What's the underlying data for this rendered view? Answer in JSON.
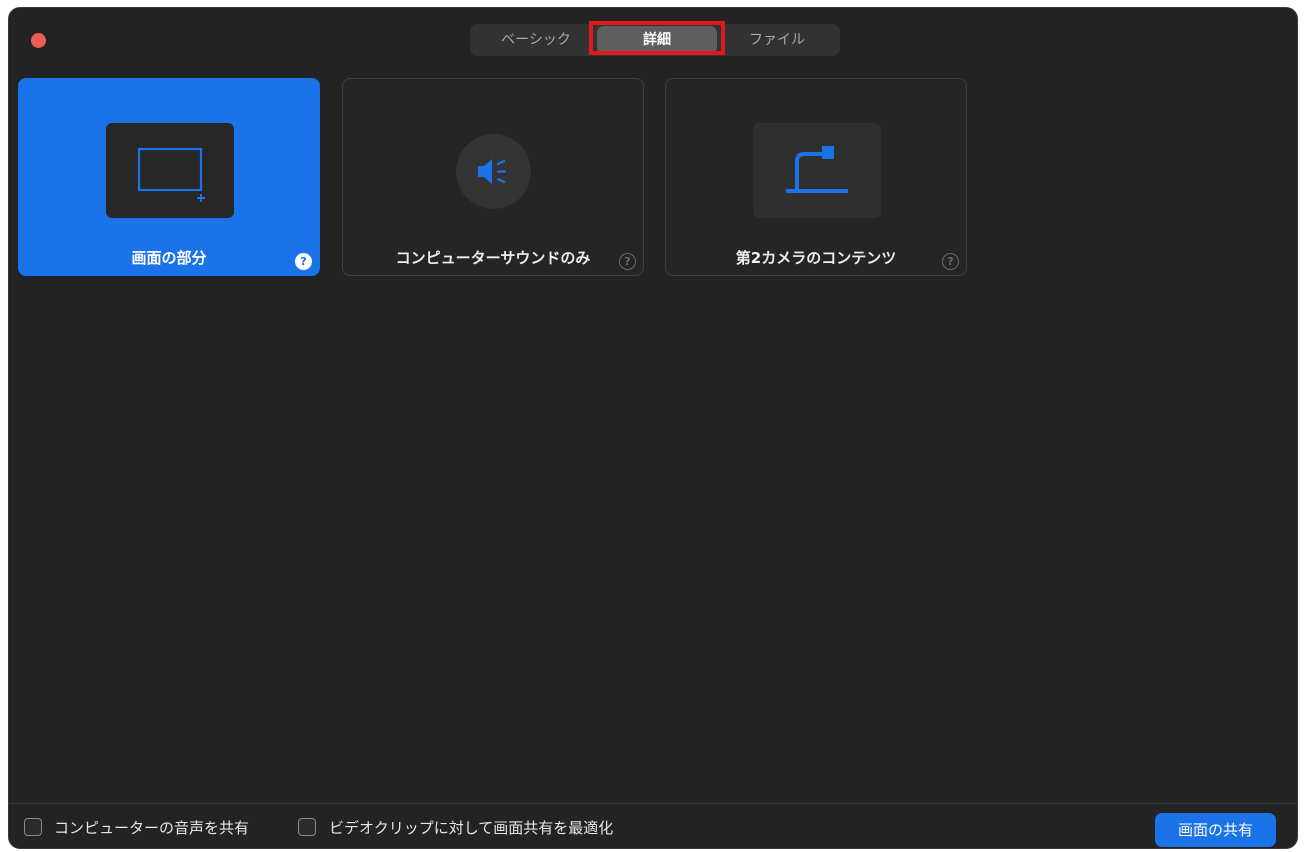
{
  "tabs": [
    {
      "label": "ベーシック",
      "active": false
    },
    {
      "label": "詳細",
      "active": true
    },
    {
      "label": "ファイル",
      "active": false
    }
  ],
  "cards": [
    {
      "label": "画面の部分",
      "icon": "screen-portion-icon",
      "selected": true,
      "help": "?"
    },
    {
      "label": "コンピューターサウンドのみ",
      "icon": "speaker-icon",
      "selected": false,
      "help": "?"
    },
    {
      "label": "第2カメラのコンテンツ",
      "icon": "document-camera-icon",
      "selected": false,
      "help": "?"
    }
  ],
  "footer": {
    "share_audio_label": "コンピューターの音声を共有",
    "optimize_video_label": "ビデオクリップに対して画面共有を最適化",
    "share_button_label": "画面の共有"
  },
  "colors": {
    "accent": "#1a73e8",
    "background": "#232323",
    "highlight": "#e01a1a",
    "close": "#ec5f56"
  }
}
